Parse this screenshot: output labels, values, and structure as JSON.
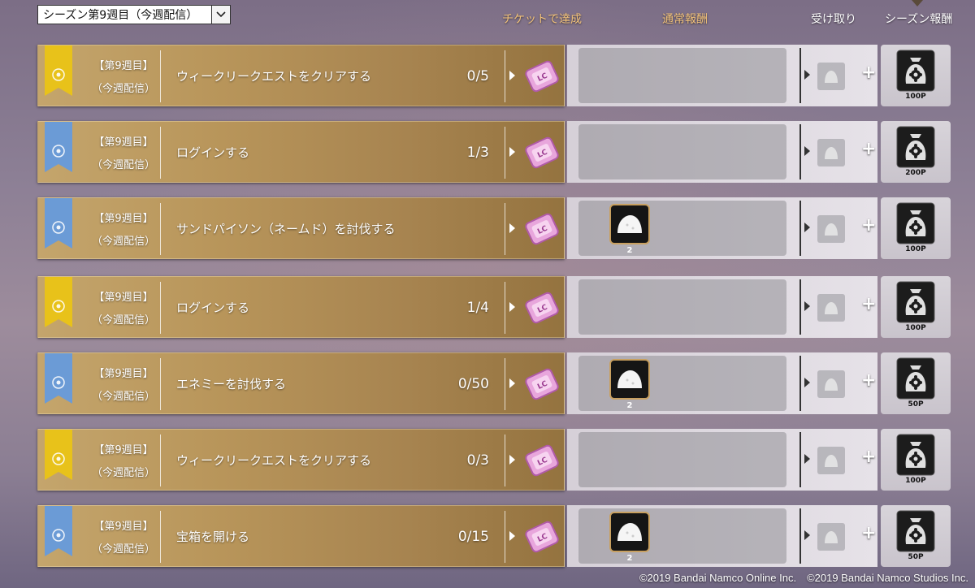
{
  "header": {
    "week_selector": "シーズン第9週目（今週配信）",
    "col_ticket": "チケットで達成",
    "col_reward": "通常報酬",
    "col_claim": "受け取り",
    "col_season": "シーズン報酬"
  },
  "quests": [
    {
      "ribbon_color": "#e8c21a",
      "week": "【第9週目】",
      "sub": "（今週配信）",
      "title": "ウィークリークエストをクリアする",
      "progress": "0/5",
      "reward_count": "",
      "points": "100P"
    },
    {
      "ribbon_color": "#6b9bd6",
      "week": "【第9週目】",
      "sub": "（今週配信）",
      "title": "ログインする",
      "progress": "1/3",
      "reward_count": "",
      "points": "200P"
    },
    {
      "ribbon_color": "#6b9bd6",
      "week": "【第9週目】",
      "sub": "（今週配信）",
      "title": "サンドパイソン（ネームド）を討伐する",
      "progress": "",
      "reward_count": "2",
      "points": "100P"
    },
    {
      "ribbon_color": "#e8c21a",
      "week": "【第9週目】",
      "sub": "（今週配信）",
      "title": "ログインする",
      "progress": "1/4",
      "reward_count": "",
      "points": "100P"
    },
    {
      "ribbon_color": "#6b9bd6",
      "week": "【第9週目】",
      "sub": "（今週配信）",
      "title": "エネミーを討伐する",
      "progress": "0/50",
      "reward_count": "2",
      "points": "50P"
    },
    {
      "ribbon_color": "#e8c21a",
      "week": "【第9週目】",
      "sub": "（今週配信）",
      "title": "ウィークリークエストをクリアする",
      "progress": "0/3",
      "reward_count": "",
      "points": "100P"
    },
    {
      "ribbon_color": "#6b9bd6",
      "week": "【第9週目】",
      "sub": "（今週配信）",
      "title": "宝箱を開ける",
      "progress": "0/15",
      "reward_count": "2",
      "points": "50P"
    }
  ],
  "footer": {
    "copyright": "©2019 Bandai Namco Online Inc.　©2019 Bandai Namco Studios Inc."
  }
}
